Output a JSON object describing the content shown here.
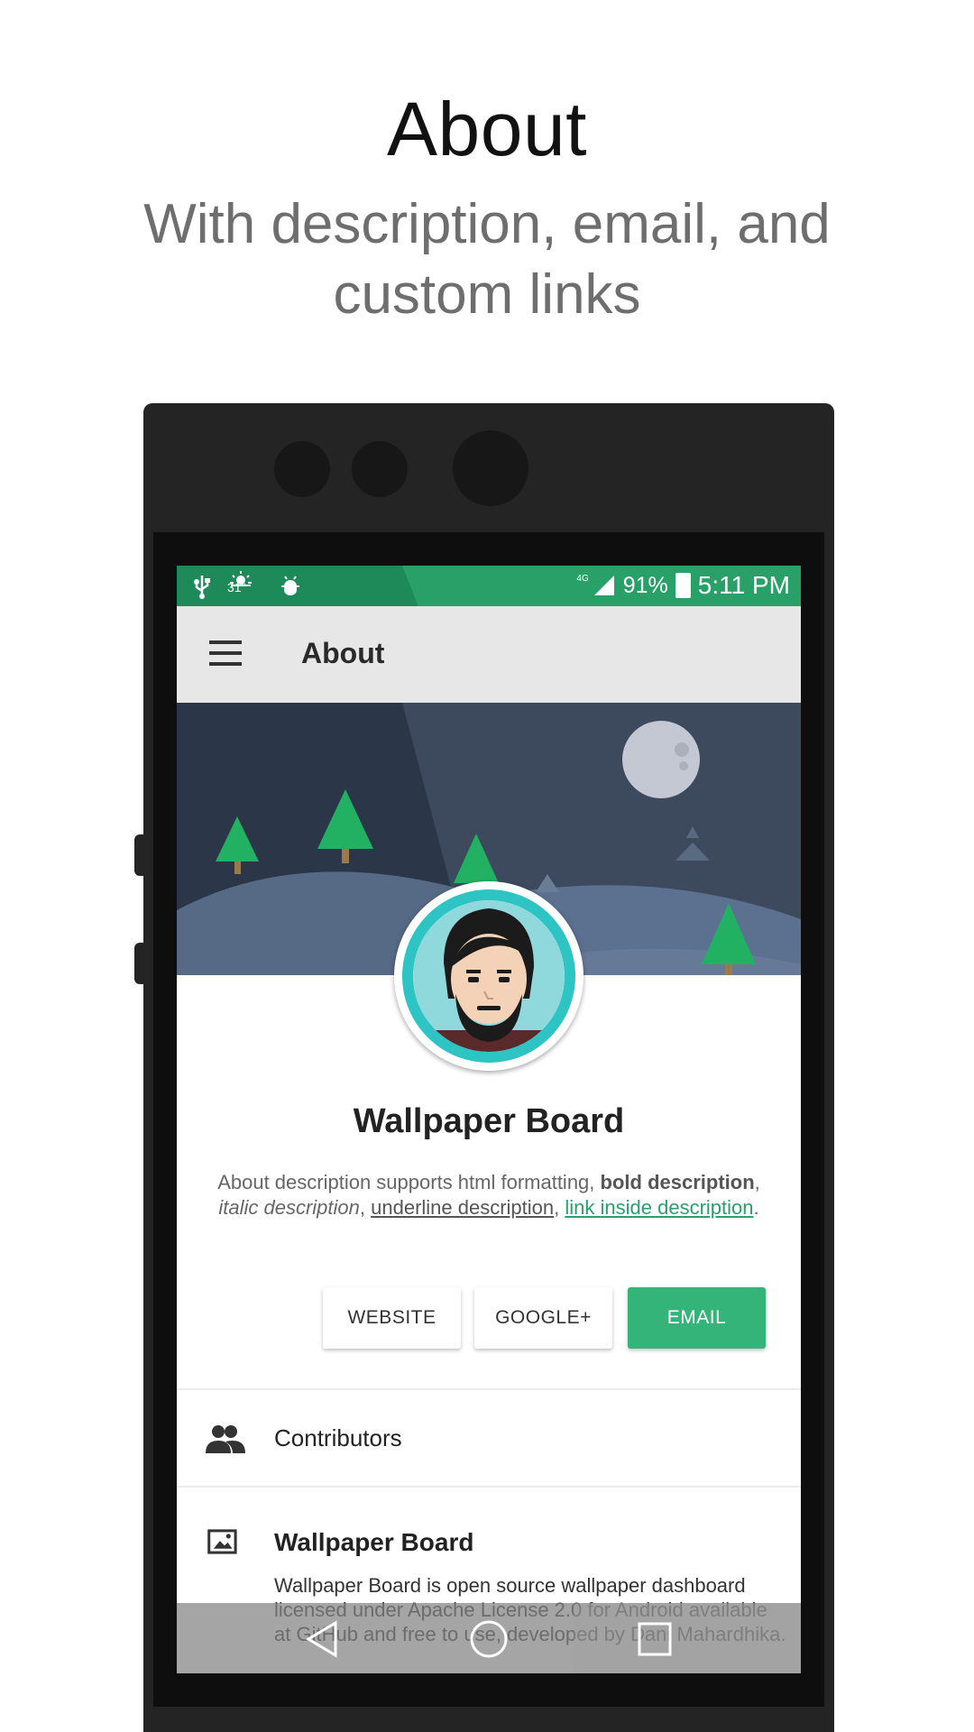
{
  "promo": {
    "title": "About",
    "subtitle": "With description, email, and custom links"
  },
  "status_bar": {
    "temperature": "31°",
    "network": "4G",
    "battery": "91%",
    "time": "5:11 PM",
    "background": "#1e8a5a"
  },
  "app_bar": {
    "title": "About",
    "menu_icon": "hamburger-menu-icon"
  },
  "about": {
    "name": "Wallpaper Board",
    "description": {
      "intro": "About description supports html formatting, ",
      "bold": "bold description",
      "sep1": ", ",
      "italic": "italic description",
      "sep2": ", ",
      "underline": "underline description",
      "sep3": ", ",
      "link": "link inside description",
      "end": "."
    },
    "buttons": {
      "website": "WEBSITE",
      "google_plus": "GOOGLE+",
      "email": "EMAIL"
    },
    "accent_color": "#34b478"
  },
  "sections": {
    "contributors": {
      "title": "Contributors",
      "icon": "people-icon"
    },
    "project": {
      "title": "Wallpaper Board",
      "icon": "wallpaper-icon",
      "body": "Wallpaper Board is open source wallpaper dashboard licensed under Apache License 2.0 for Android available at GitHub and free to use, developed by Dani Mahardhika."
    }
  },
  "nav_bar": {
    "back_icon": "back-triangle-icon",
    "home_icon": "home-circle-icon",
    "recents_icon": "recents-square-icon"
  }
}
